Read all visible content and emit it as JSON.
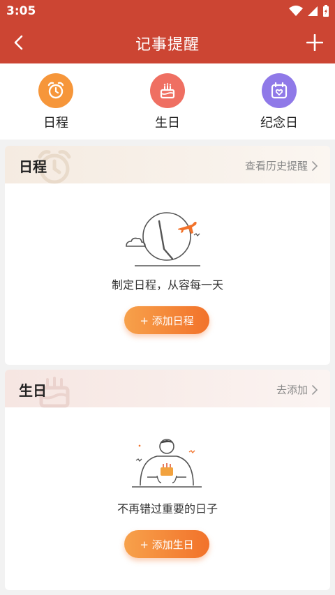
{
  "status_bar": {
    "time": "3:05"
  },
  "nav": {
    "title": "记事提醒"
  },
  "categories": [
    {
      "label": "日程",
      "icon": "alarm-clock-icon",
      "color": "#f6963a"
    },
    {
      "label": "生日",
      "icon": "birthday-cake-icon",
      "color": "#ef6f62"
    },
    {
      "label": "纪念日",
      "icon": "calendar-heart-icon",
      "color": "#8f79e8"
    }
  ],
  "schedule_card": {
    "title": "日程",
    "link_label": "查看历史提醒",
    "empty_text": "制定日程，从容每一天",
    "cta_label": "+ 添加日程"
  },
  "birthday_card": {
    "title": "生日",
    "link_label": "去添加",
    "empty_text": "不再错过重要的日子",
    "cta_label": "+ 添加生日"
  },
  "colors": {
    "header_bg": "#cc4533",
    "accent_orange": "#f2722a"
  }
}
